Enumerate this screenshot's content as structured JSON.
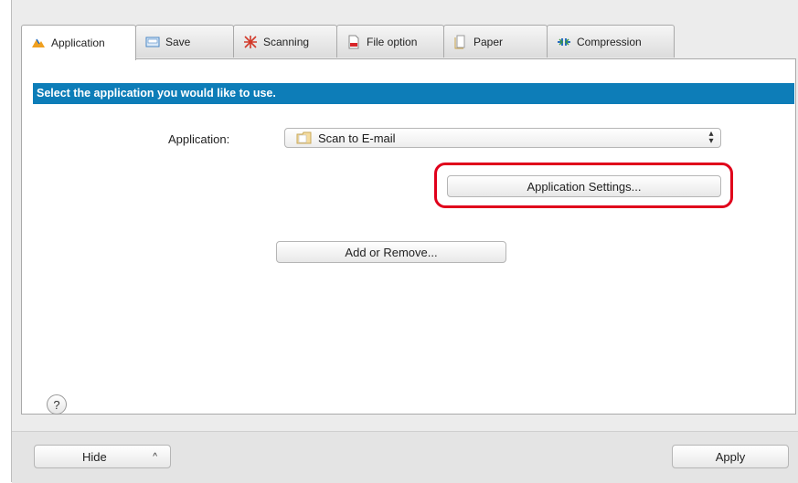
{
  "tabs": [
    {
      "label": "Application",
      "icon": "application-icon",
      "active": true
    },
    {
      "label": "Save",
      "icon": "save-icon",
      "active": false
    },
    {
      "label": "Scanning",
      "icon": "scanning-icon",
      "active": false
    },
    {
      "label": "File option",
      "icon": "file-option-icon",
      "active": false
    },
    {
      "label": "Paper",
      "icon": "paper-icon",
      "active": false
    },
    {
      "label": "Compression",
      "icon": "compression-icon",
      "active": false
    }
  ],
  "banner": {
    "text": "Select the application you would like to use."
  },
  "application": {
    "label": "Application:",
    "selected": "Scan to E-mail"
  },
  "buttons": {
    "app_settings": "Application Settings...",
    "add_remove": "Add or Remove...",
    "help": "?",
    "hide": "Hide",
    "hide_caret": "^",
    "apply": "Apply"
  },
  "colors": {
    "banner_bg": "#0d7db8",
    "highlight": "#e0001b"
  }
}
